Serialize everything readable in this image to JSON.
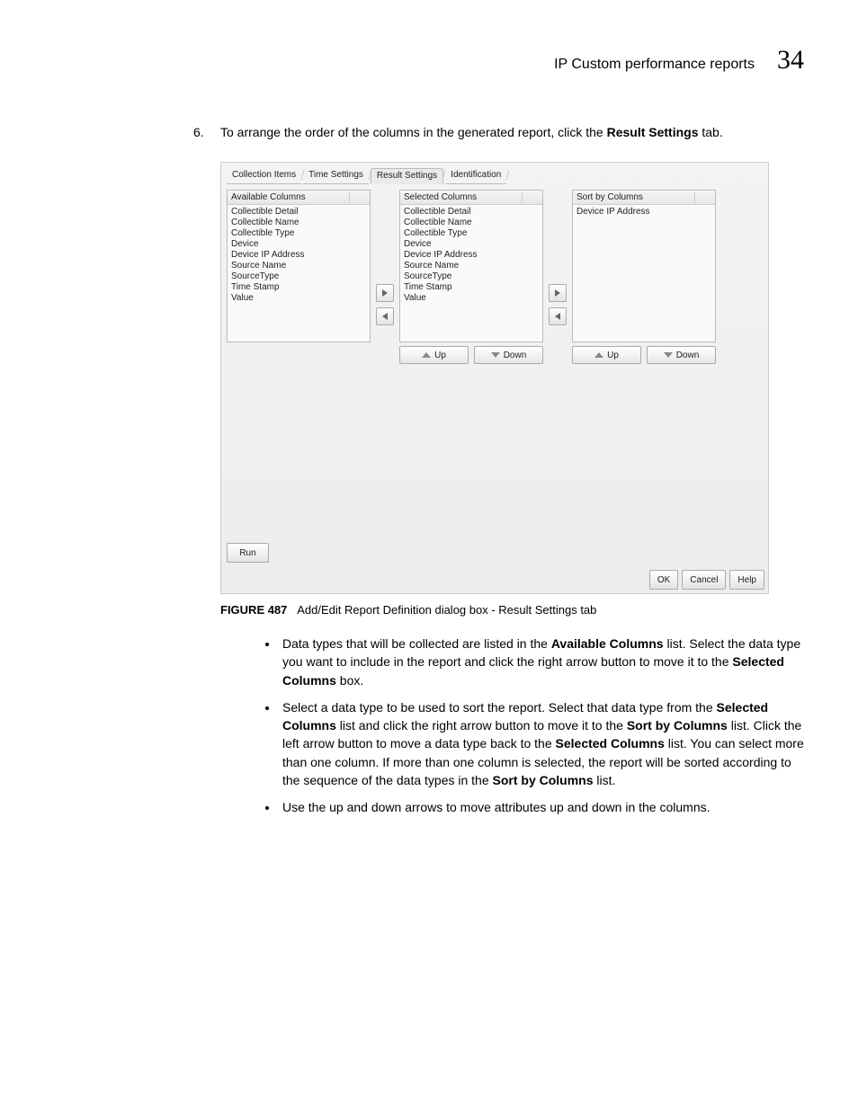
{
  "header": {
    "title": "IP Custom performance reports",
    "chapter_num": "34"
  },
  "step": {
    "num": "6.",
    "before": "To arrange the order of the columns in the generated report, click the ",
    "bold": "Result Settings",
    "after": " tab."
  },
  "dialog": {
    "tabs": [
      "Collection Items",
      "Time Settings",
      "Result Settings",
      "Identification"
    ],
    "col1_header": "Available Columns",
    "col2_header": "Selected Columns",
    "col3_header": "Sort by Columns",
    "col1_items": [
      "Collectible Detail",
      "Collectible Name",
      "Collectible Type",
      "Device",
      "Device IP Address",
      "Source Name",
      "SourceType",
      "Time Stamp",
      "Value"
    ],
    "col2_items": [
      "Collectible Detail",
      "Collectible Name",
      "Collectible Type",
      "Device",
      "Device IP Address",
      "Source Name",
      "SourceType",
      "Time Stamp",
      "Value"
    ],
    "col3_items": [
      "Device IP Address"
    ],
    "up_label": "Up",
    "down_label": "Down",
    "run_label": "Run",
    "ok_label": "OK",
    "cancel_label": "Cancel",
    "help_label": "Help"
  },
  "caption": {
    "figlabel": "FIGURE 487",
    "figtext": "Add/Edit Report Definition dialog box - Result Settings tab"
  },
  "bullets": {
    "b1": {
      "t1": "Data types that will be collected are listed in the ",
      "b1": "Available Columns",
      "t2": " list. Select the data type you want to include in the report and click the right arrow button to move it to the ",
      "b2": "Selected Columns",
      "t3": " box."
    },
    "b2": {
      "t1": "Select a data type to be used to sort the report. Select that data type from the ",
      "b1": "Selected Columns",
      "t2": " list and click the right arrow button to move it to the ",
      "b2": "Sort by Columns",
      "t3": " list. Click the left arrow button to move a data type back to the ",
      "b3": "Selected Columns",
      "t4": " list. You can select more than one column. If more than one column is selected, the report will be sorted according to the sequence of the data types in the ",
      "b4": "Sort by Columns",
      "t5": " list."
    },
    "b3": {
      "t1": "Use the up and down arrows to move attributes up and down in the columns."
    }
  }
}
